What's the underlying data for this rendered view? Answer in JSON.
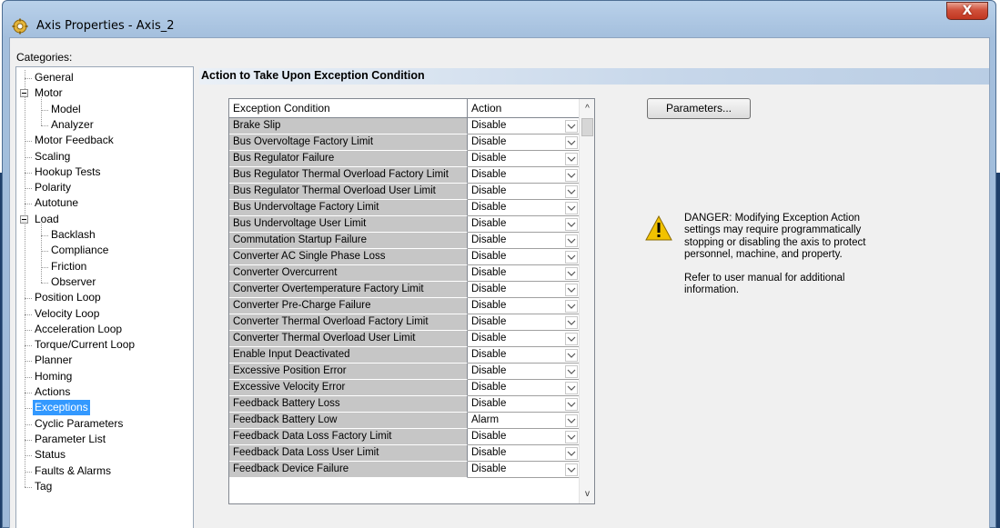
{
  "window": {
    "title": "Axis Properties - Axis_2",
    "close_glyph": "X"
  },
  "categories_label": "Categories:",
  "tree": [
    {
      "label": "General",
      "level": 1
    },
    {
      "label": "Motor",
      "level": 0,
      "expanded": true
    },
    {
      "label": "Model",
      "level": 2
    },
    {
      "label": "Analyzer",
      "level": 2
    },
    {
      "label": "Motor Feedback",
      "level": 1
    },
    {
      "label": "Scaling",
      "level": 1
    },
    {
      "label": "Hookup Tests",
      "level": 1
    },
    {
      "label": "Polarity",
      "level": 1
    },
    {
      "label": "Autotune",
      "level": 1
    },
    {
      "label": "Load",
      "level": 0,
      "expanded": true
    },
    {
      "label": "Backlash",
      "level": 2
    },
    {
      "label": "Compliance",
      "level": 2
    },
    {
      "label": "Friction",
      "level": 2
    },
    {
      "label": "Observer",
      "level": 2
    },
    {
      "label": "Position Loop",
      "level": 1
    },
    {
      "label": "Velocity Loop",
      "level": 1
    },
    {
      "label": "Acceleration Loop",
      "level": 1
    },
    {
      "label": "Torque/Current Loop",
      "level": 1
    },
    {
      "label": "Planner",
      "level": 1
    },
    {
      "label": "Homing",
      "level": 1
    },
    {
      "label": "Actions",
      "level": 1
    },
    {
      "label": "Exceptions",
      "level": 1,
      "selected": true
    },
    {
      "label": "Cyclic Parameters",
      "level": 1
    },
    {
      "label": "Parameter List",
      "level": 1
    },
    {
      "label": "Status",
      "level": 1
    },
    {
      "label": "Faults & Alarms",
      "level": 1
    },
    {
      "label": "Tag",
      "level": 1
    }
  ],
  "section_title": "Action to Take Upon Exception Condition",
  "grid": {
    "headers": [
      "Exception Condition",
      "Action"
    ],
    "rows": [
      [
        "Brake Slip",
        "Disable"
      ],
      [
        "Bus Overvoltage Factory Limit",
        "Disable"
      ],
      [
        "Bus Regulator Failure",
        "Disable"
      ],
      [
        "Bus Regulator Thermal Overload Factory Limit",
        "Disable"
      ],
      [
        "Bus Regulator Thermal Overload User Limit",
        "Disable"
      ],
      [
        "Bus Undervoltage Factory Limit",
        "Disable"
      ],
      [
        "Bus Undervoltage User Limit",
        "Disable"
      ],
      [
        "Commutation Startup Failure",
        "Disable"
      ],
      [
        "Converter AC Single Phase Loss",
        "Disable"
      ],
      [
        "Converter Overcurrent",
        "Disable"
      ],
      [
        "Converter Overtemperature Factory Limit",
        "Disable"
      ],
      [
        "Converter Pre-Charge Failure",
        "Disable"
      ],
      [
        "Converter Thermal Overload Factory Limit",
        "Disable"
      ],
      [
        "Converter Thermal Overload User Limit",
        "Disable"
      ],
      [
        "Enable Input Deactivated",
        "Disable"
      ],
      [
        "Excessive Position Error",
        "Disable"
      ],
      [
        "Excessive Velocity Error",
        "Disable"
      ],
      [
        "Feedback Battery Loss",
        "Disable"
      ],
      [
        "Feedback Battery Low",
        "Alarm"
      ],
      [
        "Feedback Data Loss Factory Limit",
        "Disable"
      ],
      [
        "Feedback Data Loss User Limit",
        "Disable"
      ],
      [
        "Feedback Device Failure",
        "Disable"
      ]
    ],
    "scroll_up_glyph": "^",
    "scroll_down_glyph": "v"
  },
  "parameters_button": "Parameters...",
  "danger": {
    "icon": "warning-icon",
    "paragraph1": "DANGER: Modifying Exception Action settings may require programmatically stopping or disabling the axis to protect personnel, machine, and property.",
    "paragraph2": "Refer to user manual for additional information."
  },
  "colors": {
    "selection": "#3399ff",
    "condition_cell": "#c6c6c6",
    "close_button": "#c13620"
  }
}
